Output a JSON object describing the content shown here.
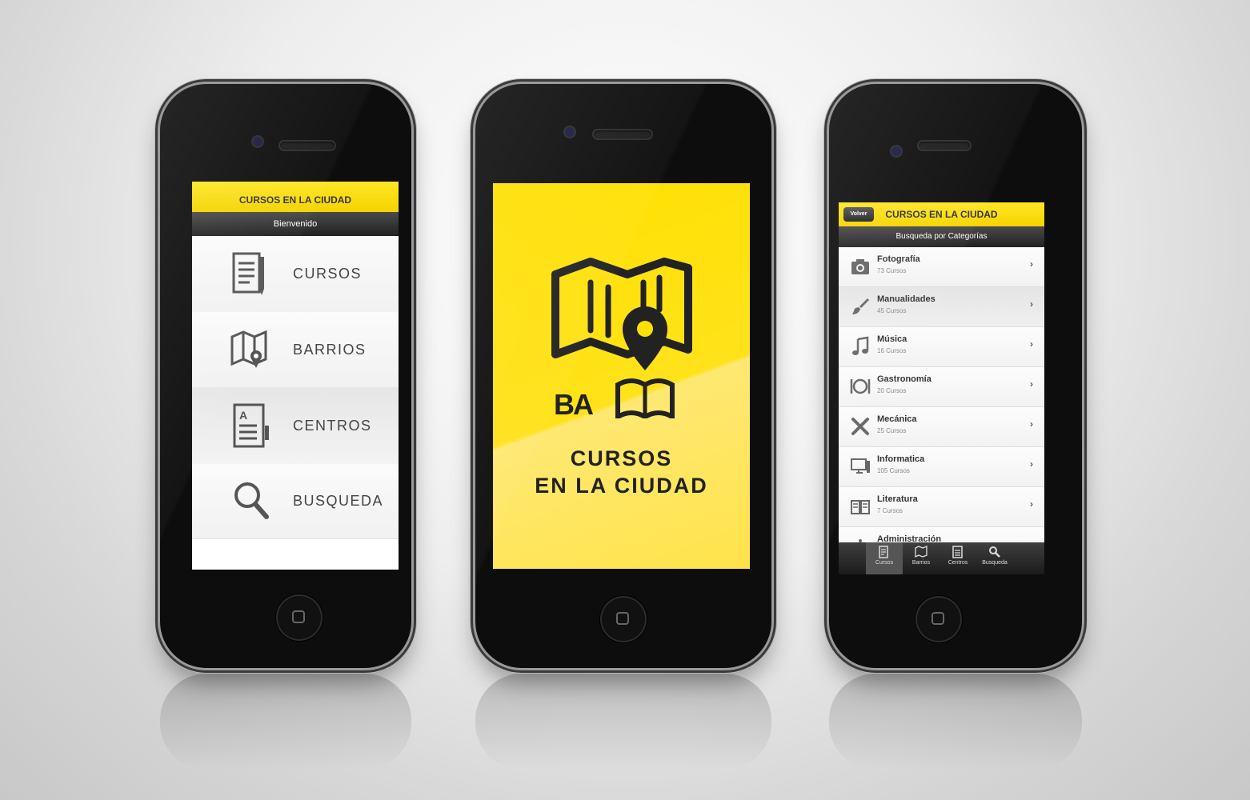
{
  "left_phone": {
    "header_title": "CURSOS EN LA CIUDAD",
    "subheader": "Bienvenido",
    "menu": [
      {
        "label": "CURSOS",
        "icon": "document-pencil-icon"
      },
      {
        "label": "BARRIOS",
        "icon": "map-pin-icon"
      },
      {
        "label": "CENTROS",
        "icon": "directory-icon"
      },
      {
        "label": "BUSQUEDA",
        "icon": "magnifier-icon"
      }
    ]
  },
  "center_phone": {
    "logo_icon": "map-pin-book-logo",
    "logo_mark": "BA",
    "title_line1": "CURSOS",
    "title_line2": "EN LA CIUDAD"
  },
  "right_phone": {
    "back_label": "Volver",
    "header_title": "CURSOS EN LA CIUDAD",
    "subheader": "Busqueda por Categorías",
    "categories": [
      {
        "name": "Fotografía",
        "count": "73 Cursos",
        "icon": "camera-icon"
      },
      {
        "name": "Manualidades",
        "count": "45 Cursos",
        "icon": "brush-icon"
      },
      {
        "name": "Música",
        "count": "16 Cursos",
        "icon": "music-note-icon"
      },
      {
        "name": "Gastronomía",
        "count": "20 Cursos",
        "icon": "plate-cutlery-icon"
      },
      {
        "name": "Mecánica",
        "count": "25 Cursos",
        "icon": "tools-icon"
      },
      {
        "name": "Informatica",
        "count": "105 Cursos",
        "icon": "computer-icon"
      },
      {
        "name": "Literatura",
        "count": "7 Cursos",
        "icon": "book-icon"
      },
      {
        "name": "Administración",
        "count": "",
        "icon": "info-icon"
      }
    ],
    "tabs": [
      {
        "label": "Cursos",
        "icon": "document-icon"
      },
      {
        "label": "Barrios",
        "icon": "map-icon"
      },
      {
        "label": "Centros",
        "icon": "directory-icon"
      },
      {
        "label": "Busqueda",
        "icon": "search-icon"
      }
    ]
  },
  "colors": {
    "brand_yellow": "#ffe000",
    "dark_bar": "#2a2a2a"
  }
}
